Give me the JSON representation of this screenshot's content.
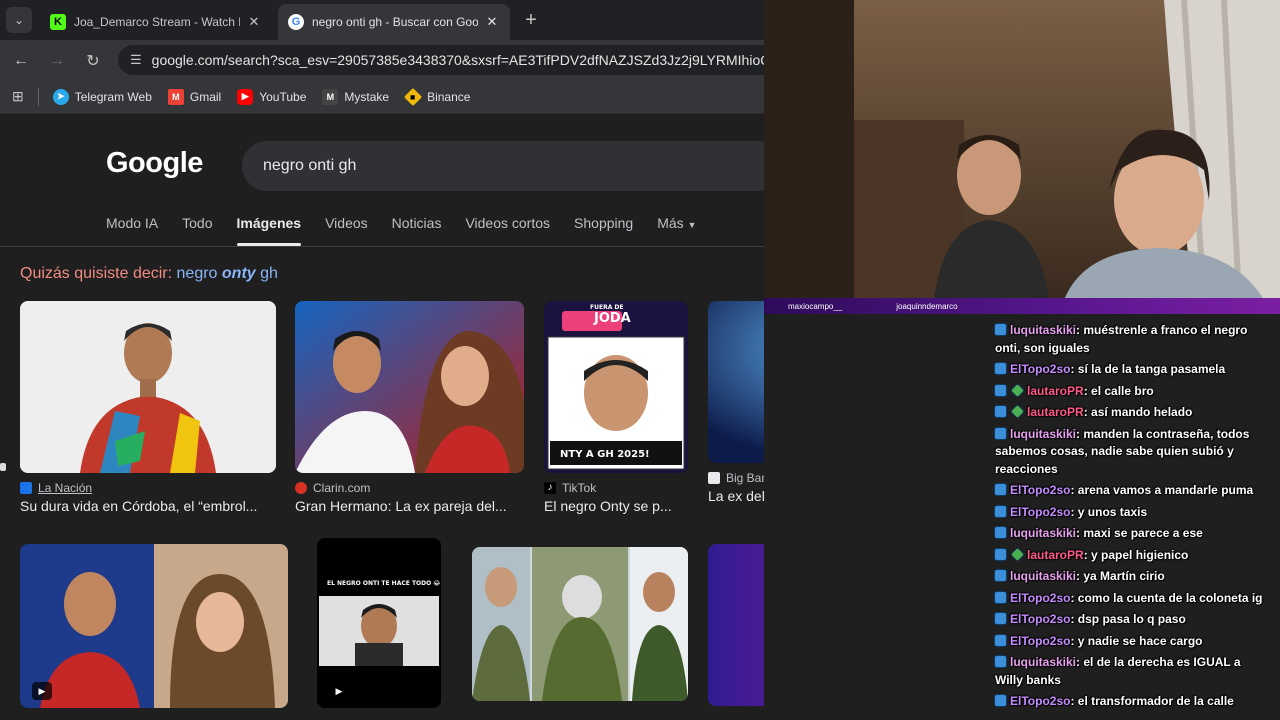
{
  "browser": {
    "tabs": [
      {
        "title": "Joa_Demarco Stream - Watch L",
        "favicon": "K",
        "active": false
      },
      {
        "title": "negro onti gh - Buscar con Goo",
        "favicon": "G",
        "active": true
      }
    ],
    "url": "google.com/search?sca_esv=29057385e3438370&sxsrf=AE3TifPDV2dfNAZJSZd3Jz2j9LYRMIhioQ:1",
    "bookmarks": [
      "Telegram Web",
      "Gmail",
      "YouTube",
      "Mystake",
      "Binance"
    ]
  },
  "google": {
    "logo": "Google",
    "query": "negro onti gh",
    "tabs": [
      "Modo IA",
      "Todo",
      "Imágenes",
      "Videos",
      "Noticias",
      "Videos cortos",
      "Shopping",
      "Más"
    ],
    "active_tab": "Imágenes",
    "did_you_mean": {
      "prefix": "Quizás quisiste decir:",
      "pre": "negro",
      "bold": "onty",
      "post": "gh"
    },
    "results": [
      {
        "source": "La Nación",
        "caption": "Su dura vida en Córdoba, el “embrol..."
      },
      {
        "source": "Clarin.com",
        "caption": "Gran Hermano: La ex pareja del..."
      },
      {
        "source": "TikTok",
        "caption": "El negro Onty se p..."
      },
      {
        "source": "Big Bang! News",
        "caption": "La ex del \"Negro\" Onty apuntó contra el ..."
      }
    ],
    "overlay_texts": {
      "fuera_de": "FUERA DE",
      "joda": "JODA",
      "onty_gh": "NTY A GH 2025!",
      "tiktok_caption": "EL NEGRO ONTI TE HACE TODO 😂"
    }
  },
  "stream": {
    "names": [
      "maxiocampo__",
      "joaquinndemarco"
    ],
    "chat": [
      {
        "user": "luquitaskiki",
        "text": ": muéstrenle a franco el negro onti, son iguales",
        "badges": 1,
        "color": "lq"
      },
      {
        "user": "ElTopo2so",
        "text": ": sí la de la tanga pasamela",
        "badges": 1,
        "color": "et"
      },
      {
        "user": "lautaroPR",
        "text": ": el calle bro",
        "badges": 2,
        "color": "lp"
      },
      {
        "user": "lautaroPR",
        "text": ": así mando helado",
        "badges": 2,
        "color": "lp"
      },
      {
        "user": "luquitaskiki",
        "text": ": manden la contraseña, todos sabemos cosas, nadie sabe quien subió y reacciones",
        "badges": 1,
        "color": "lq"
      },
      {
        "user": "ElTopo2so",
        "text": ": arena vamos a mandarle puma",
        "badges": 1,
        "color": "et"
      },
      {
        "user": "ElTopo2so",
        "text": ": y unos taxis",
        "badges": 1,
        "color": "et"
      },
      {
        "user": "luquitaskiki",
        "text": ": maxi se parece a ese",
        "badges": 1,
        "color": "lq"
      },
      {
        "user": "lautaroPR",
        "text": ": y papel higienico",
        "badges": 2,
        "color": "lp"
      },
      {
        "user": "luquitaskiki",
        "text": ": ya Martín cirio",
        "badges": 1,
        "color": "lq"
      },
      {
        "user": "ElTopo2so",
        "text": ": como la cuenta de la coloneta ig",
        "badges": 1,
        "color": "et"
      },
      {
        "user": "ElTopo2so",
        "text": ": dsp pasa lo q paso",
        "badges": 1,
        "color": "et"
      },
      {
        "user": "ElTopo2so",
        "text": ": y nadie se hace cargo",
        "badges": 1,
        "color": "et"
      },
      {
        "user": "luquitaskiki",
        "text": ": el de la derecha es IGUAL a Willy banks",
        "badges": 1,
        "color": "lq"
      },
      {
        "user": "ElTopo2so",
        "text": ": el transformador de la calle",
        "badges": 1,
        "color": "et"
      }
    ]
  },
  "colors": {
    "accent_link": "#8ab4f8",
    "didyou": "#f28b82",
    "bg": "#1f1f1f"
  }
}
